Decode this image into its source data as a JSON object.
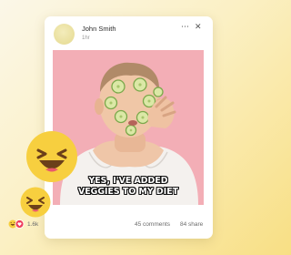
{
  "post": {
    "author_name": "John Smith",
    "time": "1hr",
    "menu_icon": "more-horizontal-icon",
    "close_icon": "close-icon",
    "caption_line1": "YES, I'VE ADDED",
    "caption_line2": "VEGGIES TO MY DIET"
  },
  "footer": {
    "reaction_icons": [
      "laugh-reaction-icon",
      "love-reaction-icon"
    ],
    "reaction_count": "1.6k",
    "comments": "45 comments",
    "shares": "84 share"
  },
  "floating_emojis": [
    "laughing-emoji-icon",
    "laughing-emoji-icon"
  ],
  "colors": {
    "background_start": "#fbf7e8",
    "background_end": "#f8df84",
    "photo_background": "#f3aeb6",
    "emoji_yellow": "#f7cf3f",
    "love_red": "#ef3e5c"
  }
}
